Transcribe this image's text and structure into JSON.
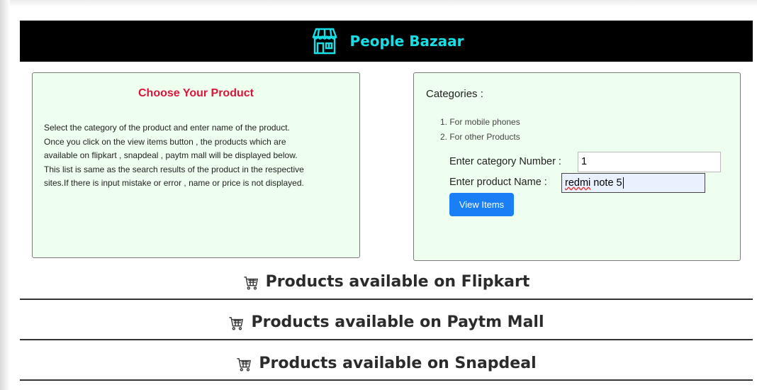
{
  "navbar": {
    "brand": "People Bazaar",
    "brand_icon": "storefront-icon",
    "brand_color": "#16e0e6"
  },
  "intro": {
    "title": "Choose Your Product",
    "lines": [
      "Select the category of the product and enter name of the product.",
      "Once you click on the view items button , the products which are",
      "available on flipkart , snapdeal , paytm mall will be displayed below.",
      "This list is same as the search results of the product in the respective",
      "sites.If there is input mistake or error , name or price is not displayed."
    ]
  },
  "form": {
    "categories_title": "Categories :",
    "categories": [
      "1. For mobile phones",
      "2. For other Products"
    ],
    "category_label": "Enter category Number :",
    "category_value": "1",
    "product_label": "Enter product Name :",
    "product_value_misspelled": "redmi",
    "product_value_rest": " note 5",
    "button_label": "View Items",
    "button_color": "#1a7ef5"
  },
  "sections": [
    {
      "title": "Products available on Flipkart",
      "icon": "cart-icon"
    },
    {
      "title": "Products available on Paytm Mall",
      "icon": "cart-icon"
    },
    {
      "title": "Products available on Snapdeal",
      "icon": "cart-icon"
    }
  ]
}
